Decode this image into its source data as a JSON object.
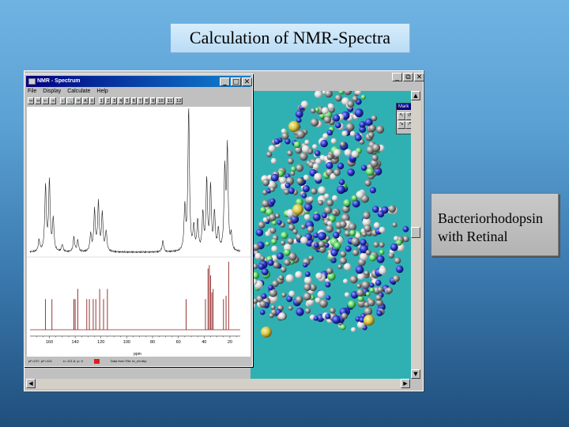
{
  "slide": {
    "title": "Calculation of NMR-Spectra",
    "caption_line1": "Bacteriorhodopsin",
    "caption_line2": "with Retinal"
  },
  "back_window": {
    "buttons": [
      "_",
      "⧉",
      "✕"
    ],
    "mark_panel": {
      "title": "Mark"
    }
  },
  "nmr_window": {
    "title": "NMR - Spectrum",
    "title_buttons": [
      "_",
      "□",
      "✕"
    ],
    "menu": [
      "File",
      "Display",
      "Calculate",
      "Help"
    ],
    "toolbar_tools": [
      "↔",
      "↔",
      "←",
      "→",
      "⌕",
      "🔍",
      "≠",
      "A",
      "λ"
    ],
    "toolbar_pages": [
      "1",
      "2",
      "3",
      "4",
      "5",
      "6",
      "7",
      "8",
      "9",
      "10",
      "11",
      "12"
    ],
    "status": {
      "cursor": "pF=237, pF=124",
      "position": "x= 121.8, y= 0",
      "data_source": "Data from File: br_ret.dbp"
    }
  },
  "chart_data": [
    {
      "type": "line",
      "name": "simulated-spectrum",
      "x_reversed": true,
      "xlim": [
        175,
        12
      ],
      "peaks": [
        {
          "x": 168,
          "h": 0.08
        },
        {
          "x": 163,
          "h": 0.45
        },
        {
          "x": 160,
          "h": 0.48
        },
        {
          "x": 157,
          "h": 0.22
        },
        {
          "x": 150,
          "h": 0.05
        },
        {
          "x": 141,
          "h": 0.1
        },
        {
          "x": 138,
          "h": 0.08
        },
        {
          "x": 128,
          "h": 0.12
        },
        {
          "x": 125,
          "h": 0.28
        },
        {
          "x": 122,
          "h": 0.33
        },
        {
          "x": 119,
          "h": 0.26
        },
        {
          "x": 116,
          "h": 0.14
        },
        {
          "x": 72,
          "h": 0.08
        },
        {
          "x": 55,
          "h": 0.3
        },
        {
          "x": 52,
          "h": 1.0
        },
        {
          "x": 48,
          "h": 0.16
        },
        {
          "x": 45,
          "h": 0.2
        },
        {
          "x": 41,
          "h": 0.25
        },
        {
          "x": 38,
          "h": 0.48
        },
        {
          "x": 35,
          "h": 0.44
        },
        {
          "x": 32,
          "h": 0.26
        },
        {
          "x": 29,
          "h": 0.14
        },
        {
          "x": 24,
          "h": 0.55
        },
        {
          "x": 22,
          "h": 0.7
        },
        {
          "x": 19,
          "h": 0.1
        }
      ]
    },
    {
      "type": "bar",
      "name": "stick-spectrum",
      "xlabel": "ppm",
      "x_ticks": [
        160,
        140,
        120,
        100,
        80,
        60,
        40,
        20
      ],
      "sticks": [
        {
          "x": 163,
          "h": 0.45
        },
        {
          "x": 158,
          "h": 0.45
        },
        {
          "x": 141,
          "h": 0.45
        },
        {
          "x": 140,
          "h": 0.45
        },
        {
          "x": 138,
          "h": 0.6
        },
        {
          "x": 131,
          "h": 0.45
        },
        {
          "x": 129,
          "h": 0.45
        },
        {
          "x": 126,
          "h": 0.45
        },
        {
          "x": 124,
          "h": 0.45
        },
        {
          "x": 121,
          "h": 0.6
        },
        {
          "x": 118,
          "h": 0.45
        },
        {
          "x": 115,
          "h": 0.6
        },
        {
          "x": 54,
          "h": 0.45
        },
        {
          "x": 39,
          "h": 0.45
        },
        {
          "x": 37,
          "h": 0.9
        },
        {
          "x": 36,
          "h": 0.95
        },
        {
          "x": 35,
          "h": 0.8
        },
        {
          "x": 34,
          "h": 0.55
        },
        {
          "x": 33,
          "h": 0.6
        },
        {
          "x": 25,
          "h": 0.45
        },
        {
          "x": 23,
          "h": 0.5
        },
        {
          "x": 21,
          "h": 1.0
        }
      ]
    }
  ]
}
